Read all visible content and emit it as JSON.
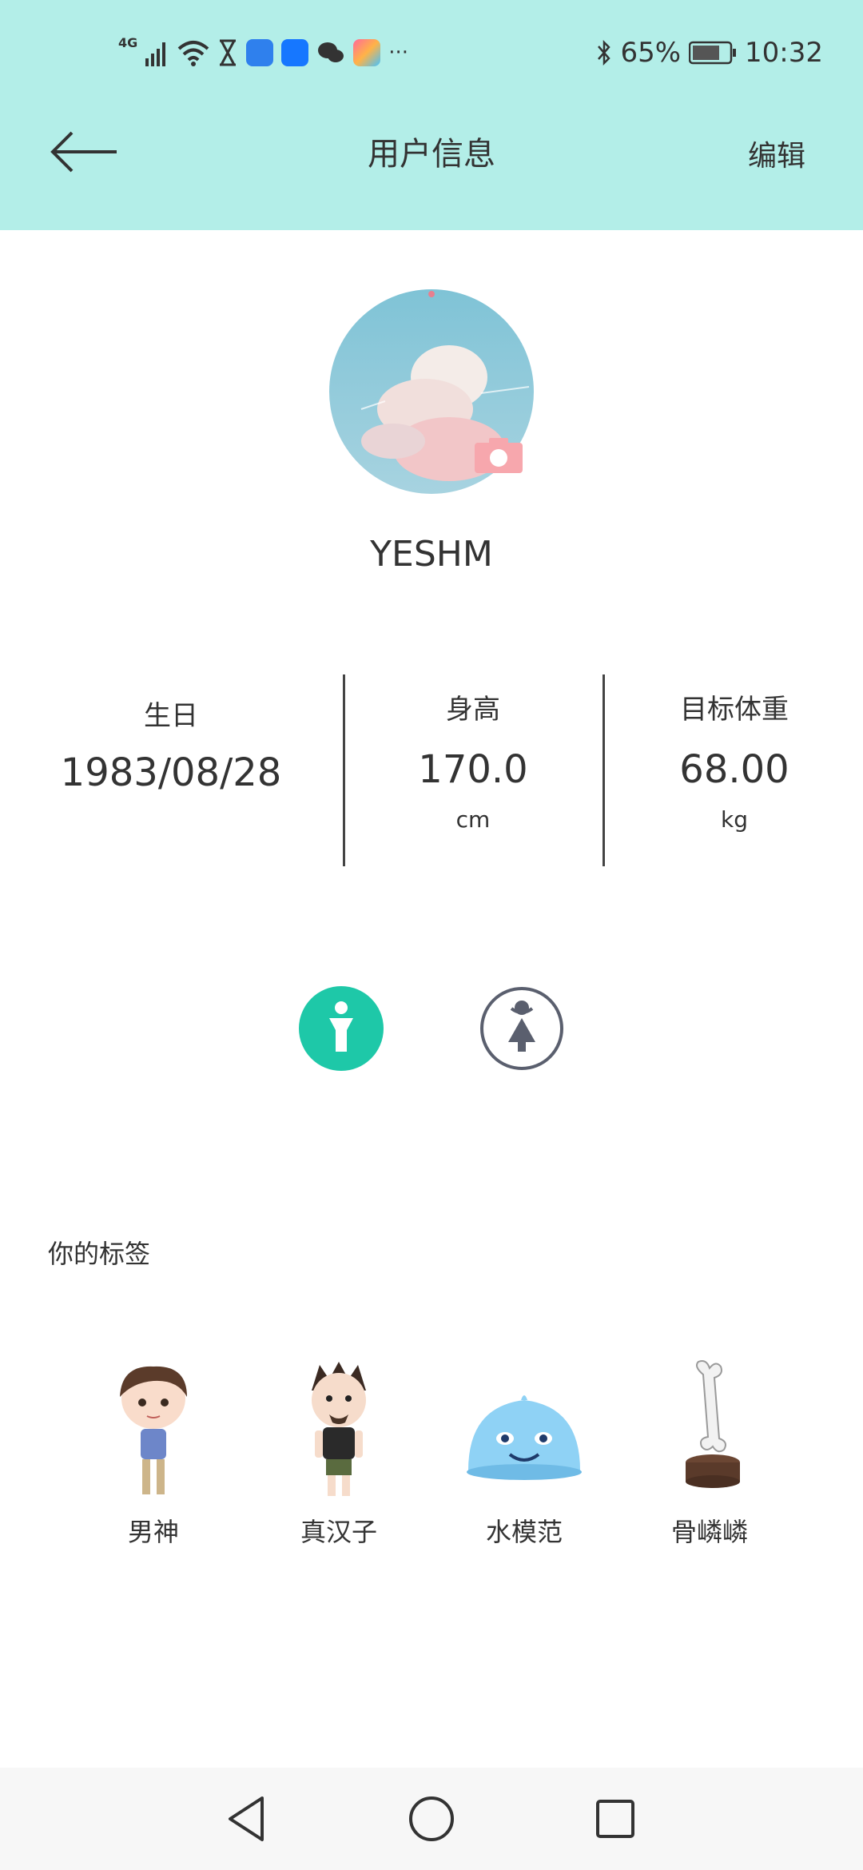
{
  "status_bar": {
    "network": "4G",
    "battery": "65%",
    "time": "10:32",
    "more": "···"
  },
  "header": {
    "title": "用户信息",
    "edit_label": "编辑"
  },
  "profile": {
    "username": "YESHM"
  },
  "stats": [
    {
      "label": "生日",
      "value": "1983/08/28",
      "unit": ""
    },
    {
      "label": "身高",
      "value": "170.0",
      "unit": "cm"
    },
    {
      "label": "目标体重",
      "value": "68.00",
      "unit": "kg"
    }
  ],
  "gender": {
    "selected": "male"
  },
  "tags": {
    "title": "你的标签",
    "items": [
      {
        "label": "男神"
      },
      {
        "label": "真汉子"
      },
      {
        "label": "水模范"
      },
      {
        "label": "骨嶙嶙"
      }
    ]
  },
  "colors": {
    "header_bg": "#b3eee8",
    "accent": "#1ec8a8",
    "gender_outline": "#5a5f6e"
  }
}
